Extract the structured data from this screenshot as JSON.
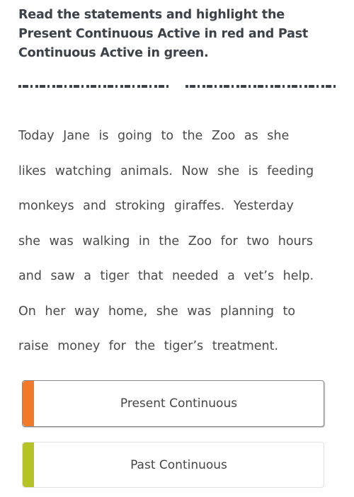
{
  "instruction": {
    "title": "Read the statements and highlight the Present Continuous Active in red and Past Continuous Active in green."
  },
  "passage": {
    "lines": [
      "Today Jane is going to the Zoo as she",
      "likes watching animals. Now she is feeding",
      "monkeys and stroking giraffes. Yesterday",
      "she was walking in the Zoo for two hours",
      "and saw a tiger that needed a vet’s help.",
      "On her way home, she was planning to",
      "raise money for the tiger’s treatment."
    ]
  },
  "options": [
    {
      "label": "Present Continuous",
      "accent_color": "#f07a2a",
      "selected": true
    },
    {
      "label": "Past Continuous",
      "accent_color": "#b5c424",
      "selected": false
    }
  ]
}
